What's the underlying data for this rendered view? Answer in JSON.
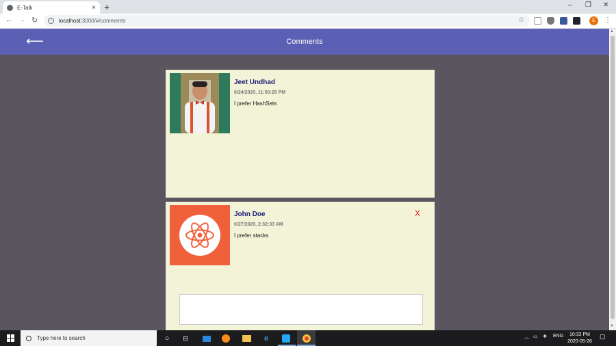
{
  "browser": {
    "tab_title": "E-Talk",
    "tab_close": "×",
    "new_tab": "+",
    "url_host": "localhost",
    "url_rest": ":3000/#/comments",
    "profile_initial": "E"
  },
  "app": {
    "back_arrow": "⟵",
    "title": "Comments",
    "header_color": "#5c60b5"
  },
  "comments": [
    {
      "author": "Jeet Undhad",
      "date": "6/24/2020, 11:50:28 PM",
      "text": "I prefer HashSets",
      "deletable": false,
      "avatar": "person-photo"
    },
    {
      "author": "John Doe",
      "date": "6/27/2020, 2:32:33 AM",
      "text": "I prefer stacks",
      "deletable": true,
      "delete_label": "X",
      "avatar": "react-logo-icon"
    }
  ],
  "taskbar": {
    "search_placeholder": "Type here to search",
    "language": "ENG",
    "time": "10:32 PM",
    "date": "2020-05-26"
  }
}
